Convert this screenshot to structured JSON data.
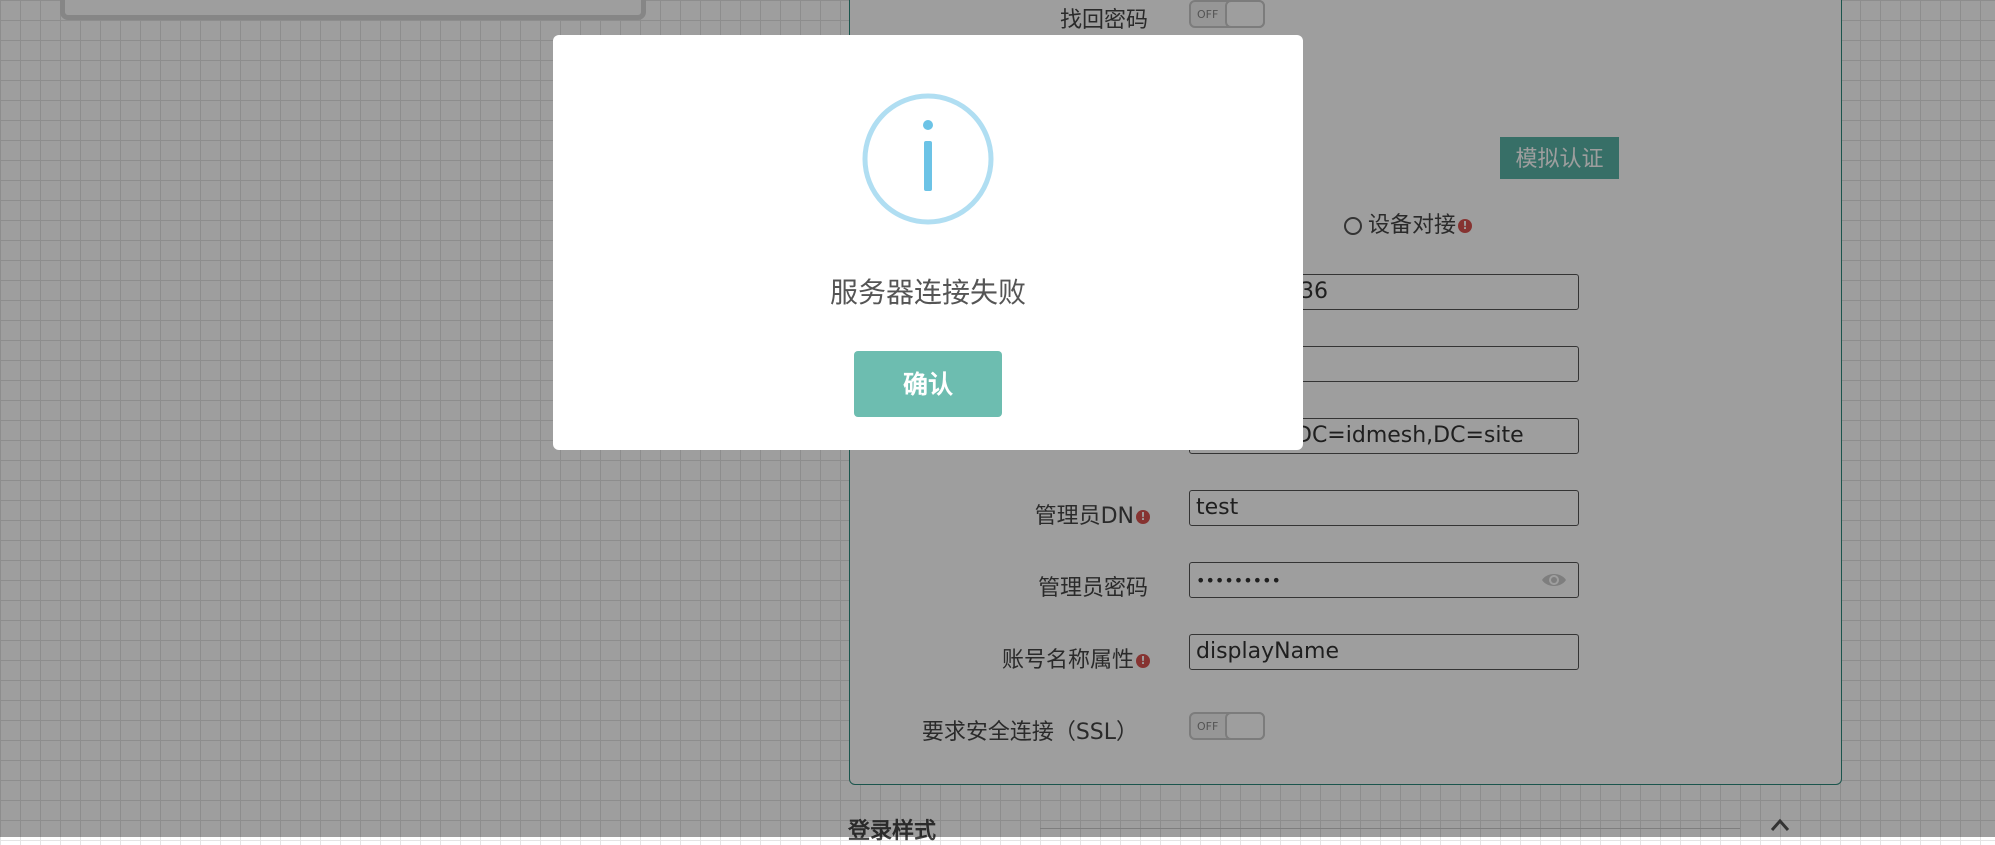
{
  "form": {
    "recover_password_label": "找回密码",
    "recover_password_toggle": "OFF",
    "simulate_auth_button": "模拟认证",
    "device_connect_radio": "设备对接",
    "server_field_value": "36",
    "port_field_value": "",
    "base_dn_value": "DC=idmesh,DC=site",
    "admin_dn_label": "管理员DN",
    "admin_dn_value": "test",
    "admin_password_label": "管理员密码",
    "admin_password_value": "•••••••••",
    "account_name_attr_label": "账号名称属性",
    "account_name_attr_value": "displayName",
    "require_ssl_label": "要求安全连接（SSL）",
    "require_ssl_toggle": "OFF",
    "info_mark": "!"
  },
  "section": {
    "login_style_title": "登录样式"
  },
  "dialog": {
    "message": "服务器连接失败",
    "confirm_label": "确认",
    "icon": "info-icon"
  },
  "colors": {
    "accent": "#6dbdb0",
    "info_blue": "#6cc3e6",
    "warning_red": "#d9534f"
  }
}
